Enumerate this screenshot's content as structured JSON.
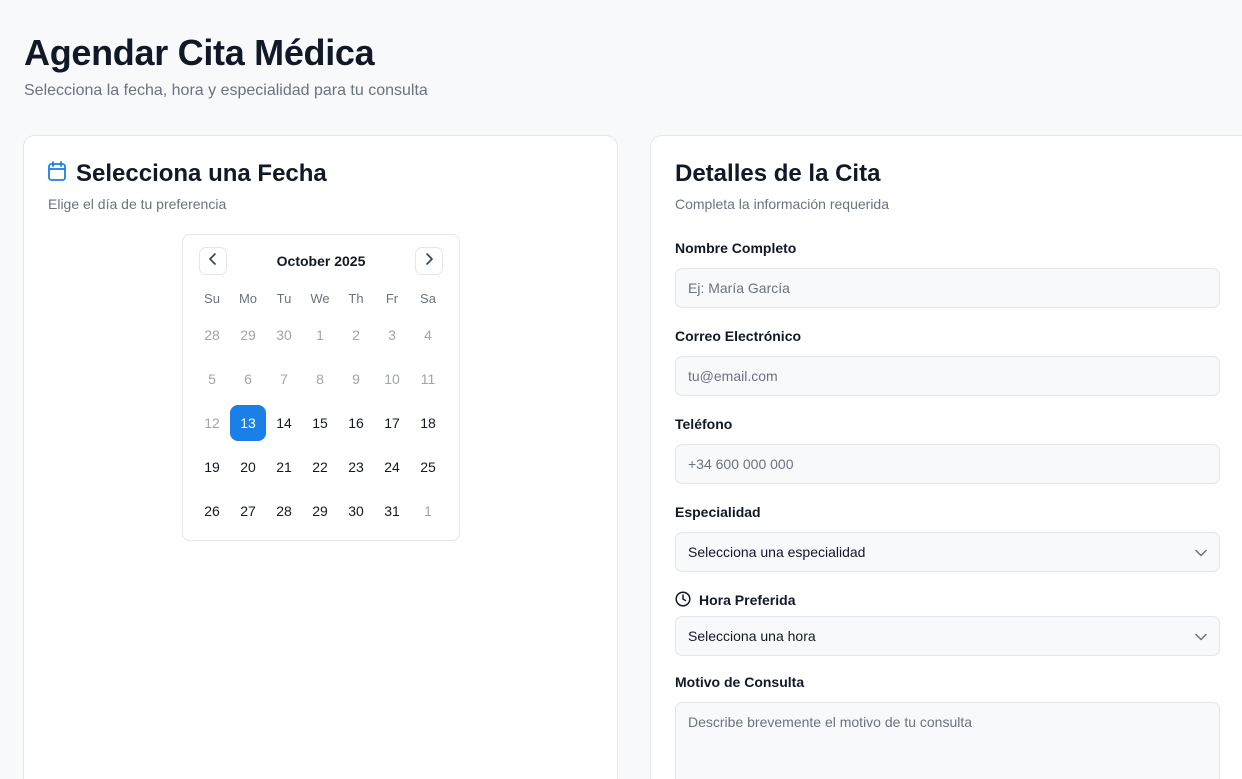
{
  "header": {
    "title": "Agendar Cita Médica",
    "subtitle": "Selecciona la fecha, hora y especialidad para tu consulta"
  },
  "date_card": {
    "title": "Selecciona una Fecha",
    "description": "Elige el día de tu preferencia",
    "calendar": {
      "month_label": "October 2025",
      "weekdays": [
        "Su",
        "Mo",
        "Tu",
        "We",
        "Th",
        "Fr",
        "Sa"
      ],
      "weeks": [
        [
          "28",
          "29",
          "30",
          "1",
          "2",
          "3",
          "4"
        ],
        [
          "5",
          "6",
          "7",
          "8",
          "9",
          "10",
          "11"
        ],
        [
          "12",
          "13",
          "14",
          "15",
          "16",
          "17",
          "18"
        ],
        [
          "19",
          "20",
          "21",
          "22",
          "23",
          "24",
          "25"
        ],
        [
          "26",
          "27",
          "28",
          "29",
          "30",
          "31",
          "1"
        ]
      ],
      "selected_day": "13"
    }
  },
  "details_card": {
    "title": "Detalles de la Cita",
    "description": "Completa la información requerida",
    "fields": {
      "name": {
        "label": "Nombre Completo",
        "placeholder": "Ej: María García"
      },
      "email": {
        "label": "Correo Electrónico",
        "placeholder": "tu@email.com"
      },
      "phone": {
        "label": "Teléfono",
        "placeholder": "+34 600 000 000"
      },
      "specialty": {
        "label": "Especialidad",
        "value": "Selecciona una especialidad"
      },
      "time": {
        "label": "Hora Preferida",
        "value": "Selecciona una hora"
      },
      "reason": {
        "label": "Motivo de Consulta",
        "placeholder": "Describe brevemente el motivo de tu consulta"
      }
    }
  },
  "colors": {
    "accent": "#1a7fe6",
    "background": "#f8f9fb",
    "border": "#e3e6eb"
  }
}
